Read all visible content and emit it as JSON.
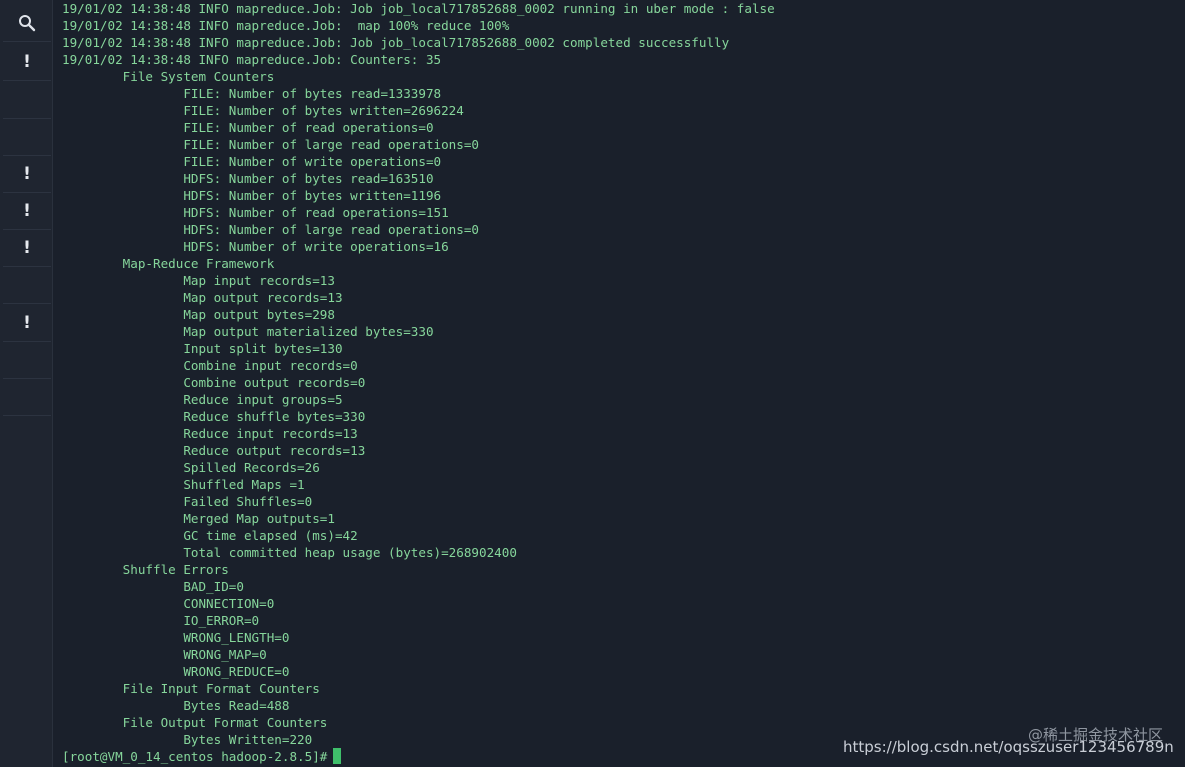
{
  "sidebar": {
    "items": [
      {
        "icon": "search-icon",
        "glyph": ""
      },
      {
        "icon": "alert-icon",
        "glyph": "!"
      },
      {
        "icon": "",
        "glyph": ""
      },
      {
        "icon": "",
        "glyph": ""
      },
      {
        "icon": "alert-icon",
        "glyph": "!"
      },
      {
        "icon": "alert-icon",
        "glyph": "!"
      },
      {
        "icon": "alert-icon",
        "glyph": "!"
      },
      {
        "icon": "",
        "glyph": ""
      },
      {
        "icon": "alert-icon",
        "glyph": "!"
      },
      {
        "icon": "",
        "glyph": ""
      },
      {
        "icon": "",
        "glyph": ""
      }
    ]
  },
  "terminal": {
    "lines": [
      "19/01/02 14:38:48 INFO mapreduce.Job: Job job_local717852688_0002 running in uber mode : false",
      "19/01/02 14:38:48 INFO mapreduce.Job:  map 100% reduce 100%",
      "19/01/02 14:38:48 INFO mapreduce.Job: Job job_local717852688_0002 completed successfully",
      "19/01/02 14:38:48 INFO mapreduce.Job: Counters: 35",
      "        File System Counters",
      "                FILE: Number of bytes read=1333978",
      "                FILE: Number of bytes written=2696224",
      "                FILE: Number of read operations=0",
      "                FILE: Number of large read operations=0",
      "                FILE: Number of write operations=0",
      "                HDFS: Number of bytes read=163510",
      "                HDFS: Number of bytes written=1196",
      "                HDFS: Number of read operations=151",
      "                HDFS: Number of large read operations=0",
      "                HDFS: Number of write operations=16",
      "        Map-Reduce Framework",
      "                Map input records=13",
      "                Map output records=13",
      "                Map output bytes=298",
      "                Map output materialized bytes=330",
      "                Input split bytes=130",
      "                Combine input records=0",
      "                Combine output records=0",
      "                Reduce input groups=5",
      "                Reduce shuffle bytes=330",
      "                Reduce input records=13",
      "                Reduce output records=13",
      "                Spilled Records=26",
      "                Shuffled Maps =1",
      "                Failed Shuffles=0",
      "                Merged Map outputs=1",
      "                GC time elapsed (ms)=42",
      "                Total committed heap usage (bytes)=268902400",
      "        Shuffle Errors",
      "                BAD_ID=0",
      "                CONNECTION=0",
      "                IO_ERROR=0",
      "                WRONG_LENGTH=0",
      "                WRONG_MAP=0",
      "                WRONG_REDUCE=0",
      "        File Input Format Counters",
      "                Bytes Read=488",
      "        File Output Format Counters",
      "                Bytes Written=220"
    ],
    "prompt": "[root@VM_0_14_centos hadoop-2.8.5]#"
  },
  "watermark": {
    "line1": "@稀土掘金技术社区",
    "line2": "https://blog.csdn.net/oqsszuser123456789n"
  },
  "colors": {
    "background": "#1a202b",
    "text": "#86d69b",
    "cursor": "#3fbf6b"
  }
}
